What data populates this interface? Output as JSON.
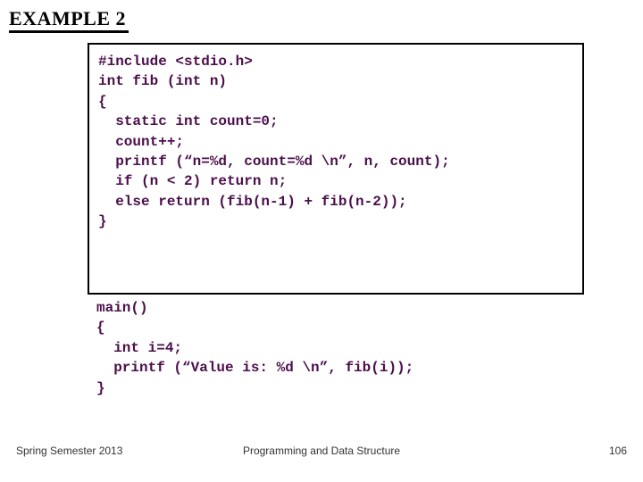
{
  "title": "EXAMPLE 2",
  "code": {
    "l0": "#include <stdio.h>",
    "l1": "",
    "l2": "int fib (int n)",
    "l3": "{",
    "l4": "  static int count=0;",
    "l5": "  count++;",
    "l6": "  printf (“n=%d, count=%d \\n”, n, count);",
    "l7": "  if (n < 2) return n;",
    "l8": "  else return (fib(n-1) + fib(n-2));",
    "l9": "}",
    "l10": "main()",
    "l11": "{",
    "l12": "  int i=4;",
    "l13": "  printf (“Value is: %d \\n”, fib(i));",
    "l14": "}"
  },
  "footer": {
    "left": "Spring Semester 2013",
    "center": "Programming and Data Structure",
    "right": "106"
  }
}
